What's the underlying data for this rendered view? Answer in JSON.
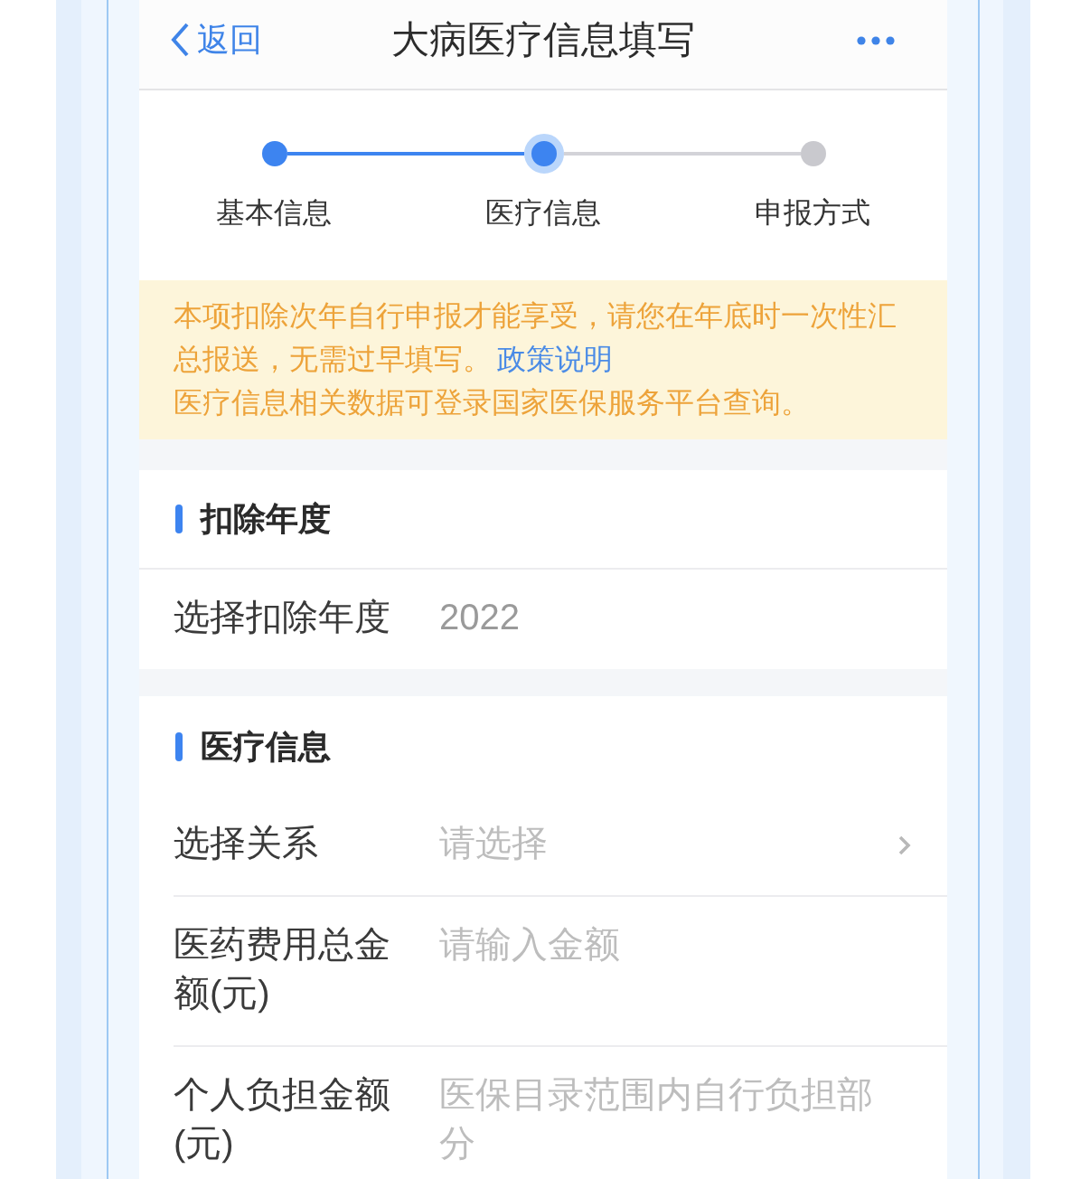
{
  "header": {
    "back_label": "返回",
    "title": "大病医疗信息填写"
  },
  "steps": [
    {
      "label": "基本信息",
      "selected": false
    },
    {
      "label": "医疗信息",
      "selected": true
    },
    {
      "label": "申报方式",
      "selected": false
    }
  ],
  "notice": {
    "paragraphs": [
      {
        "text": "本项扣除次年自行申报才能享受，请您在年底时一次性汇总报送，无需过早填写。",
        "link": "政策说明"
      },
      {
        "text": "医疗信息相关数据可登录国家医保服务平台查询。"
      }
    ]
  },
  "sections": [
    {
      "title": "扣除年度",
      "fields": [
        {
          "kind": "picker",
          "label": "选择扣除年度",
          "value": "2022"
        }
      ]
    },
    {
      "title": "医疗信息",
      "fields": [
        {
          "kind": "select",
          "label": "选择关系",
          "placeholder": "请选择"
        },
        {
          "kind": "input",
          "label": "医药费用总金额(元)",
          "placeholder": "请输入金额"
        },
        {
          "kind": "input",
          "label": "个人负担金额(元)",
          "placeholder": "医保目录范围内自行负担部分"
        }
      ]
    }
  ]
}
